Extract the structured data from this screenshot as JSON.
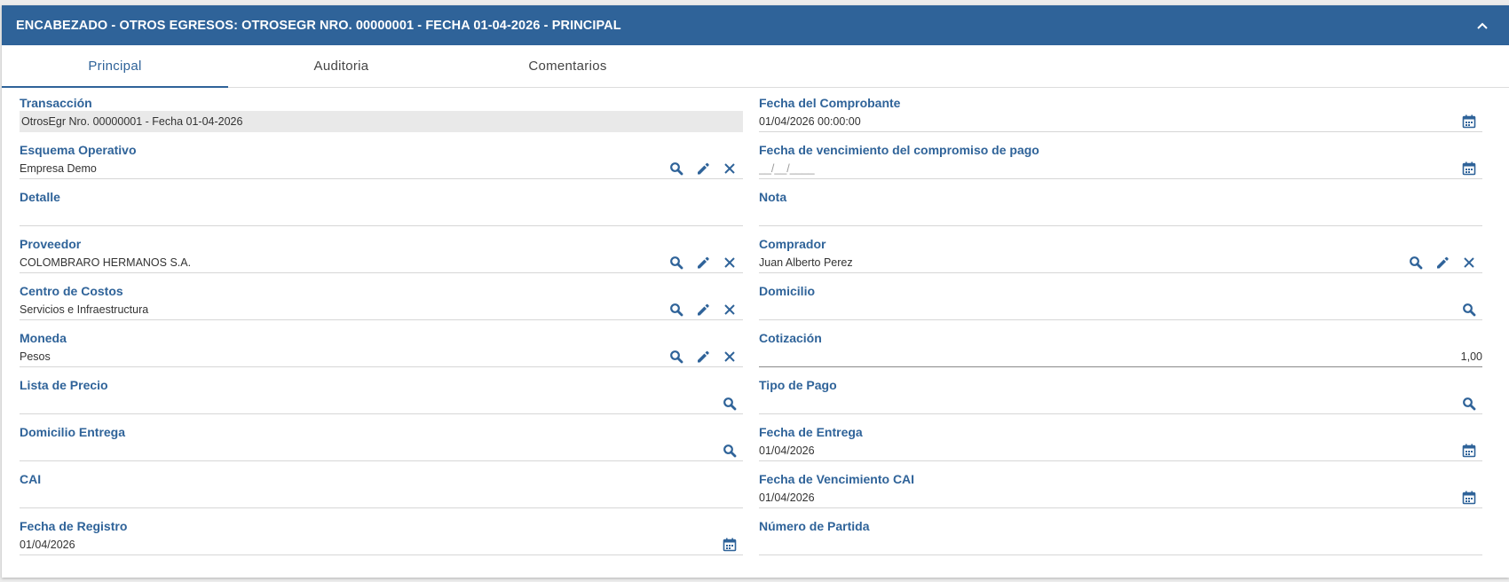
{
  "header": {
    "title": "ENCABEZADO - OTROS EGRESOS: OTROSEGR NRO. 00000001 - FECHA 01-04-2026 - PRINCIPAL"
  },
  "tabs": [
    {
      "label": "Principal",
      "active": true
    },
    {
      "label": "Auditoria",
      "active": false
    },
    {
      "label": "Comentarios",
      "active": false
    }
  ],
  "colors": {
    "primary": "#2f6399",
    "header_bg": "#2f6399",
    "disabled_bg": "#e9e9e9"
  },
  "left": {
    "transaccion": {
      "label": "Transacción",
      "value": "OtrosEgr Nro.  00000001 - Fecha 01-04-2026"
    },
    "esquema": {
      "label": "Esquema Operativo",
      "value": "Empresa Demo"
    },
    "detalle": {
      "label": "Detalle",
      "value": ""
    },
    "proveedor": {
      "label": "Proveedor",
      "value": "COLOMBRARO HERMANOS S.A."
    },
    "centro": {
      "label": "Centro de Costos",
      "value": "Servicios e Infraestructura"
    },
    "moneda": {
      "label": "Moneda",
      "value": "Pesos"
    },
    "lista": {
      "label": "Lista de Precio",
      "value": ""
    },
    "domicilio_entrega": {
      "label": "Domicilio Entrega",
      "value": ""
    },
    "cai": {
      "label": "CAI",
      "value": ""
    },
    "fecha_registro": {
      "label": "Fecha de Registro",
      "value": "01/04/2026"
    }
  },
  "right": {
    "fecha_comprobante": {
      "label": "Fecha del Comprobante",
      "value": "01/04/2026 00:00:00"
    },
    "fecha_vencimiento": {
      "label": "Fecha de vencimiento del compromiso de pago",
      "placeholder": "__/__/____"
    },
    "nota": {
      "label": "Nota",
      "value": ""
    },
    "comprador": {
      "label": "Comprador",
      "value": "Juan Alberto Perez"
    },
    "domicilio": {
      "label": "Domicilio",
      "value": ""
    },
    "cotizacion": {
      "label": "Cotización",
      "value": "1,00"
    },
    "tipo_pago": {
      "label": "Tipo de Pago",
      "value": ""
    },
    "fecha_entrega": {
      "label": "Fecha de Entrega",
      "value": "01/04/2026"
    },
    "fecha_venc_cai": {
      "label": "Fecha de Vencimiento CAI",
      "value": "01/04/2026"
    },
    "numero_partida": {
      "label": "Número de Partida",
      "value": ""
    }
  },
  "icons": {
    "search": "search-icon",
    "edit": "pencil-icon",
    "clear": "close-icon",
    "calendar": "calendar-icon",
    "collapse": "chevron-up-icon"
  }
}
